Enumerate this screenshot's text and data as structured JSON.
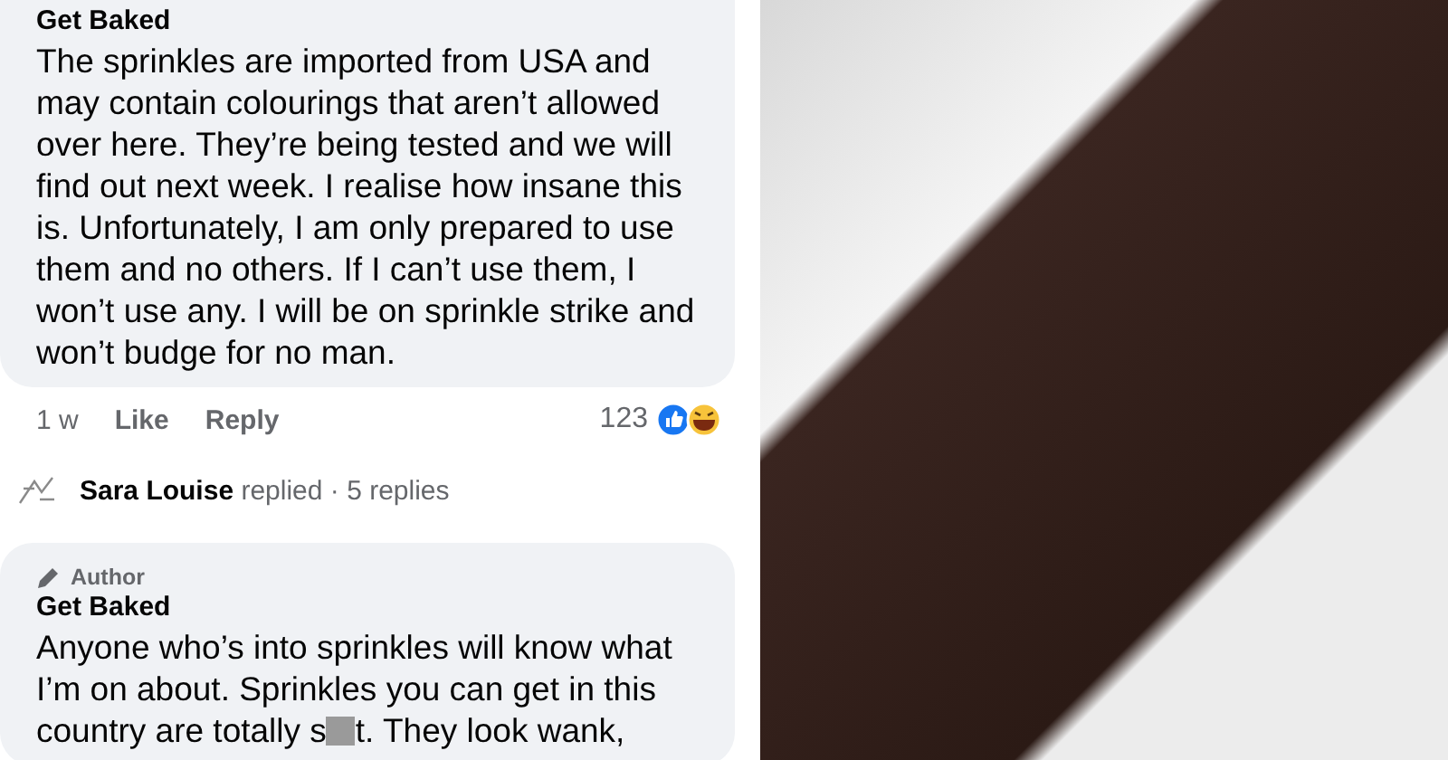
{
  "comments": [
    {
      "author": "Get Baked",
      "body": "The sprinkles are imported from USA and may contain colourings that aren’t allowed over here. They’re being tested and we will find out next week. I realise how insane this is. Unfortunately, I am only prepared to use them and no others. If I can’t use them, I won’t use any. I will be on sprinkle strike and won’t budge for no man.",
      "time": "1 w",
      "actions": [
        "Like",
        "Reply"
      ],
      "reaction_count": "123",
      "replies_summary": "**Sara Louise** replied · 5 replies"
    },
    {
      "badge": "Author",
      "author": "Get Baked",
      "body_before_censor": "Anyone who’s into sprinkles will know what I’m on about. Sprinkles you can get in this country are totally s",
      "body_after_censor": "t. They look wank,"
    }
  ]
}
